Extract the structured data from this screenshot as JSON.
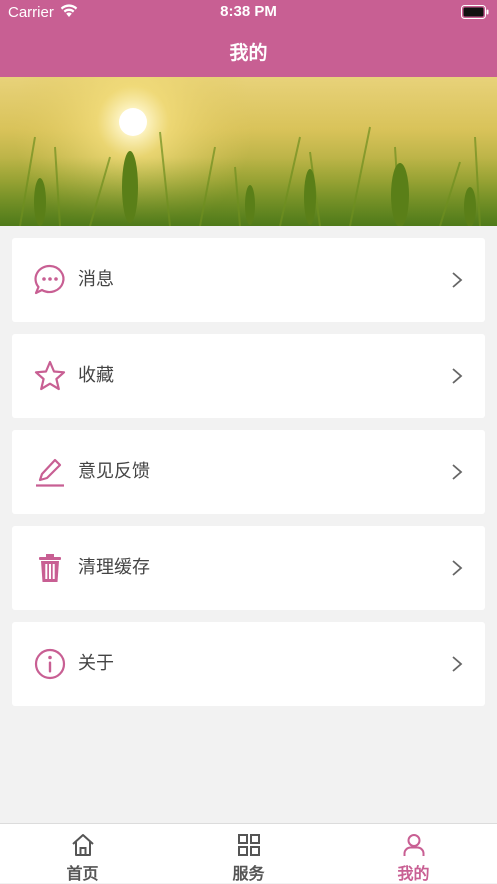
{
  "status_bar": {
    "carrier": "Carrier",
    "time": "8:38 PM"
  },
  "header": {
    "title": "我的"
  },
  "menu": {
    "items": [
      {
        "label": "消息",
        "icon": "message-icon"
      },
      {
        "label": "收藏",
        "icon": "star-icon"
      },
      {
        "label": "意见反馈",
        "icon": "edit-icon"
      },
      {
        "label": "清理缓存",
        "icon": "trash-icon"
      },
      {
        "label": "关于",
        "icon": "info-icon"
      }
    ]
  },
  "tabbar": {
    "tabs": [
      {
        "label": "首页",
        "icon": "home-icon"
      },
      {
        "label": "服务",
        "icon": "grid-icon"
      },
      {
        "label": "我的",
        "icon": "person-icon"
      }
    ],
    "active_index": 2
  },
  "colors": {
    "accent": "#c85f93",
    "background": "#f2f2f2",
    "text": "#444444"
  }
}
